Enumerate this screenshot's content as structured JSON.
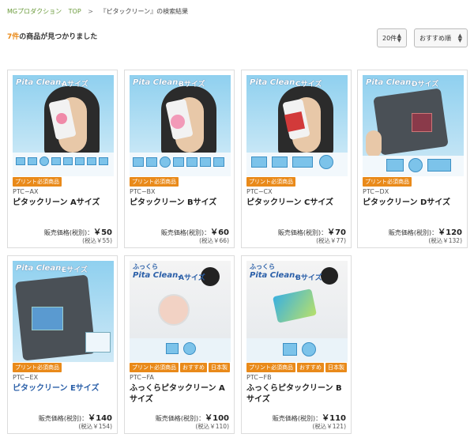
{
  "breadcrumb": {
    "home": "MGプロダクション",
    "top": "TOP",
    "separator": ">",
    "current": "『ピタックリーン』の検索結果"
  },
  "results": {
    "count": "7件",
    "suffix": "の商品が見つかりました"
  },
  "controls": {
    "per_page": "20件",
    "sort": "おすすめ順"
  },
  "labels": {
    "price_prefix": "販売価格(税別)：",
    "print_required": "プリント必須商品",
    "recommended": "おすすめ",
    "made_in_japan": "日本製"
  },
  "colors": {
    "accent": "#e98a1a",
    "link": "#6a9a3a"
  },
  "products": [
    {
      "code": "PTC−AX",
      "name": "ピタックリーン Aサイズ",
      "price": "￥50",
      "tax_in": "(税込￥55)",
      "thumb_brand": "Pita Clean.",
      "thumb_size": "Aサイズ"
    },
    {
      "code": "PTC−BX",
      "name": "ピタックリーン Bサイズ",
      "price": "￥60",
      "tax_in": "(税込￥66)",
      "thumb_brand": "Pita Clean.",
      "thumb_size": "Bサイズ"
    },
    {
      "code": "PTC−CX",
      "name": "ピタックリーン Cサイズ",
      "price": "￥70",
      "tax_in": "(税込￥77)",
      "thumb_brand": "Pita Clean.",
      "thumb_size": "Cサイズ"
    },
    {
      "code": "PTC−DX",
      "name": "ピタックリーン Dサイズ",
      "price": "￥120",
      "tax_in": "(税込￥132)",
      "thumb_brand": "Pita Clean.",
      "thumb_size": "Dサイズ"
    },
    {
      "code": "PTC−EX",
      "name": "ピタックリーン Eサイズ",
      "price": "￥140",
      "tax_in": "(税込￥154)",
      "thumb_brand": "Pita Clean.",
      "thumb_size": "Eサイズ"
    },
    {
      "code": "PTC−FA",
      "name": "ふっくらピタックリーン Aサイズ",
      "price": "￥100",
      "tax_in": "(税込￥110)",
      "thumb_brand": "Pita Clean.",
      "thumb_size": "Aサイズ",
      "thumb_prefix": "ふっくら"
    },
    {
      "code": "PTC−FB",
      "name": "ふっくらピタックリーン Bサイズ",
      "price": "￥110",
      "tax_in": "(税込￥121)",
      "thumb_brand": "Pita Clean.",
      "thumb_size": "Bサイズ",
      "thumb_prefix": "ふっくら"
    }
  ]
}
